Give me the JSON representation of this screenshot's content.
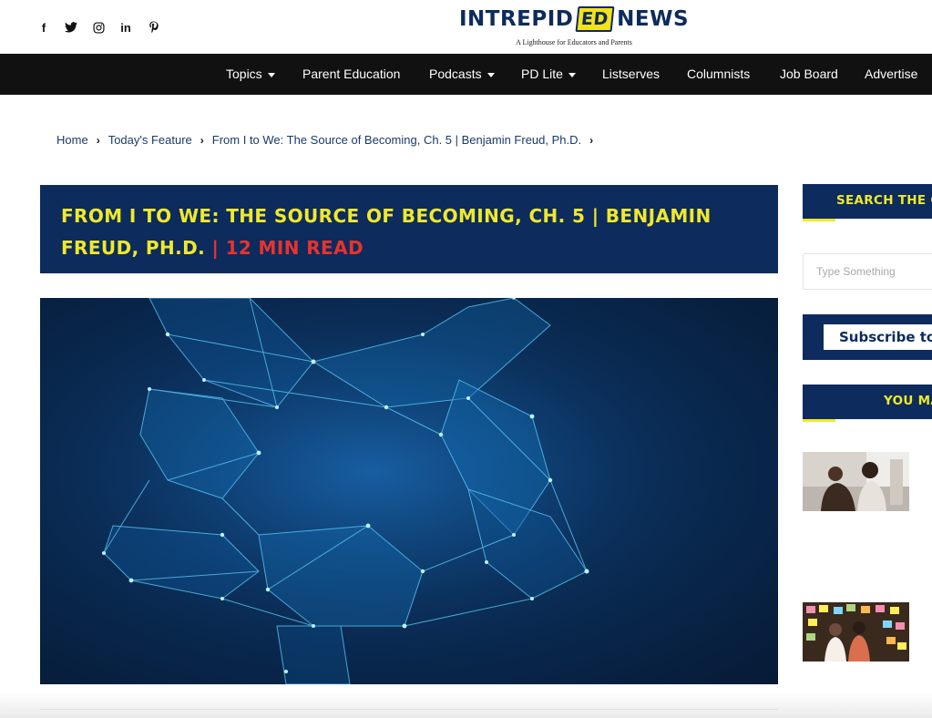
{
  "header": {
    "social": [
      {
        "name": "facebook-icon",
        "glyph": "f"
      },
      {
        "name": "twitter-icon",
        "glyph": "🐦"
      },
      {
        "name": "instagram-icon",
        "glyph": "◎"
      },
      {
        "name": "linkedin-icon",
        "glyph": "in"
      },
      {
        "name": "pinterest-icon",
        "glyph": "℗"
      }
    ],
    "logo": {
      "part1": "INTREPID",
      "ed": "ED",
      "part2": "NEWS",
      "tagline": "A Lighthouse for Educators and Parents"
    }
  },
  "nav": {
    "items": [
      {
        "label": "Topics",
        "dropdown": true
      },
      {
        "label": "Parent Education",
        "dropdown": false
      },
      {
        "label": "Podcasts",
        "dropdown": true
      },
      {
        "label": "PD Lite",
        "dropdown": true
      },
      {
        "label": "Listserves",
        "dropdown": false
      },
      {
        "label": "Columnists",
        "dropdown": false
      },
      {
        "label": "Job Board",
        "dropdown": false
      },
      {
        "label": "Advertise",
        "dropdown": false
      }
    ]
  },
  "breadcrumb": {
    "home": "Home",
    "section": "Today's Feature",
    "current": "From I to We: The Source of Becoming, Ch. 5 | Benjamin Freud, Ph.D.",
    "sep": "›"
  },
  "article": {
    "title": "FROM I TO WE: THE SOURCE OF BECOMING, CH. 5 | BENJAMIN FREUD, PH.D.",
    "separator": " | ",
    "read_time": "12 MIN READ"
  },
  "sidebar": {
    "search_heading": "SEARCH THE C",
    "search_placeholder": "Type Something",
    "subscribe_label": "Subscribe to",
    "you_may_heading": "YOU MA"
  },
  "colors": {
    "brand_navy": "#0d2b5c",
    "brand_yellow": "#f0e92a",
    "accent_red": "#e8332e",
    "nav_bg": "#111111"
  }
}
